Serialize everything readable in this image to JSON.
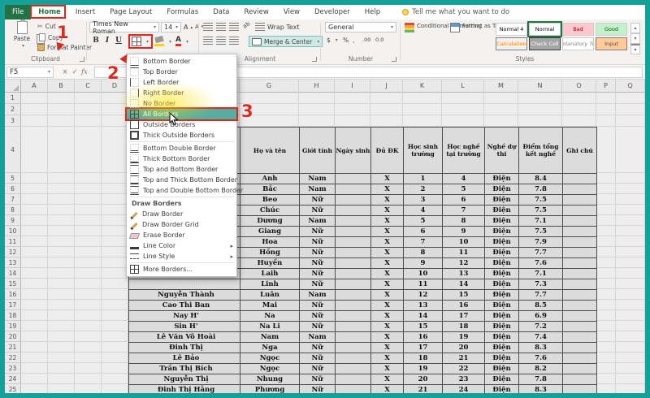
{
  "colors": {
    "frame": "#16a09a",
    "excel_green": "#217346",
    "annotation_red": "#e0251b",
    "highlight_yellow": "#ffe000",
    "menu_hover_teal": "#57aea0",
    "merge_highlight": "#cdeae6"
  },
  "tabs": {
    "items": [
      "File",
      "Home",
      "Insert",
      "Page Layout",
      "Formulas",
      "Data",
      "Review",
      "View",
      "Developer",
      "Help"
    ],
    "active": "Home",
    "tell_me": "Tell me what you want to do"
  },
  "ribbon": {
    "clipboard": {
      "paste": "Paste",
      "cut": "Cut",
      "copy": "Copy",
      "format_painter": "Format Painter",
      "label": "Clipboard"
    },
    "font": {
      "font_name": "Times New Roman",
      "font_size": "14",
      "bold": "B",
      "italic": "I",
      "underline": "U"
    },
    "alignment": {
      "wrap_text": "Wrap Text",
      "merge_center": "Merge & Center",
      "label": "Alignment"
    },
    "number": {
      "format": "General",
      "currency": "$",
      "percent": "%",
      "comma": ",",
      "decimal_increase": ".00",
      "decimal_decrease": "0.0",
      "label": "Number"
    },
    "styles": {
      "conditional": "Conditional Formatting",
      "format_table": "Format as Table",
      "label": "Styles",
      "gallery": [
        {
          "name": "Normal 4",
          "bg": "#ffffff",
          "color": "#000000"
        },
        {
          "name": "Normal",
          "bg": "#ffffff",
          "color": "#000000",
          "selected": true
        },
        {
          "name": "Bad",
          "bg": "#ffc7ce",
          "color": "#9c0006"
        },
        {
          "name": "Good",
          "bg": "#c6efce",
          "color": "#006100"
        },
        {
          "name": "Calculation",
          "bg": "#f2f2f2",
          "color": "#fa7d00",
          "border": "#7f7f7f"
        },
        {
          "name": "Check Cell",
          "bg": "#a5a5a5",
          "color": "#ffffff",
          "border": "#3f3f3f"
        },
        {
          "name": "Explanatory Text",
          "bg": "#ffffff",
          "color": "#7f7f7f",
          "italic": true
        },
        {
          "name": "Input",
          "bg": "#ffcc99",
          "color": "#3f3f76",
          "border": "#7f7f7f"
        }
      ]
    }
  },
  "formula_bar": {
    "name_box": "F5",
    "cancel": "×",
    "enter": "✓",
    "fx": "fx"
  },
  "sheet": {
    "columns": [
      "A",
      "B",
      "C",
      "D",
      "E",
      "F",
      "G",
      "H",
      "I",
      "J",
      "K",
      "L",
      "M",
      "N",
      "O",
      "P",
      "Q"
    ],
    "visible_rows": 25
  },
  "menu": {
    "items": [
      {
        "type": "item",
        "label": "Bottom Border",
        "icon": "bottom"
      },
      {
        "type": "item",
        "label": "Top Border",
        "icon": "top"
      },
      {
        "type": "item",
        "label": "Left Border",
        "icon": "left"
      },
      {
        "type": "item",
        "label": "Right Border",
        "icon": "right"
      },
      {
        "type": "item",
        "label": "No Border",
        "icon": "none"
      },
      {
        "type": "item",
        "label": "All Borders",
        "icon": "all",
        "highlight": true
      },
      {
        "type": "item",
        "label": "Outside Borders",
        "icon": "outside"
      },
      {
        "type": "item",
        "label": "Thick Outside Borders",
        "icon": "thick-outside"
      },
      {
        "type": "sep"
      },
      {
        "type": "item",
        "label": "Bottom Double Border",
        "icon": "bottom-double"
      },
      {
        "type": "item",
        "label": "Thick Bottom Border",
        "icon": "thick-bottom"
      },
      {
        "type": "item",
        "label": "Top and Bottom Border",
        "icon": "top-bottom"
      },
      {
        "type": "item",
        "label": "Top and Thick Bottom Border",
        "icon": "top-thick-bottom"
      },
      {
        "type": "item",
        "label": "Top and Double Bottom Border",
        "icon": "top-double-bottom"
      },
      {
        "type": "sep"
      },
      {
        "type": "header",
        "label": "Draw Borders"
      },
      {
        "type": "item",
        "label": "Draw Border",
        "icon": "draw"
      },
      {
        "type": "item",
        "label": "Draw Border Grid",
        "icon": "draw-grid"
      },
      {
        "type": "item",
        "label": "Erase Border",
        "icon": "erase"
      },
      {
        "type": "item",
        "label": "Line Color",
        "icon": "line-color",
        "submenu": true
      },
      {
        "type": "item",
        "label": "Line Style",
        "icon": "line-style",
        "submenu": true
      },
      {
        "type": "sep"
      },
      {
        "type": "item",
        "label": "More Borders...",
        "icon": "more"
      }
    ]
  },
  "annotations": {
    "step1": "1",
    "step2": "2",
    "step3": "3"
  },
  "table": {
    "headers": [
      "",
      "Họ và tên",
      "Giới tính",
      "Ngày sinh",
      "Đủ ĐK",
      "Học sinh trường",
      "Học nghề tại trường",
      "Nghề dự thi",
      "Điểm tổng kết nghề",
      "Ghi chú"
    ],
    "rows": [
      {
        "family": "",
        "given": "Anh",
        "gender": "Nam",
        "birth": "",
        "qualified": "X",
        "school_no": "1",
        "vocation_no": "4",
        "job": "Điện",
        "score": "8.4",
        "note": ""
      },
      {
        "family": "",
        "given": "Bắc",
        "gender": "Nam",
        "birth": "",
        "qualified": "X",
        "school_no": "2",
        "vocation_no": "5",
        "job": "Điện",
        "score": "7.8",
        "note": ""
      },
      {
        "family": "",
        "given": "Beo",
        "gender": "Nữ",
        "birth": "",
        "qualified": "X",
        "school_no": "3",
        "vocation_no": "6",
        "job": "Điện",
        "score": "7.5",
        "note": ""
      },
      {
        "family": "",
        "given": "Chúc",
        "gender": "Nữ",
        "birth": "",
        "qualified": "X",
        "school_no": "4",
        "vocation_no": "7",
        "job": "Điện",
        "score": "7.5",
        "note": ""
      },
      {
        "family": "",
        "given": "Dương",
        "gender": "Nam",
        "birth": "",
        "qualified": "X",
        "school_no": "5",
        "vocation_no": "8",
        "job": "Điện",
        "score": "7.1",
        "note": ""
      },
      {
        "family": "",
        "given": "Giang",
        "gender": "Nữ",
        "birth": "",
        "qualified": "X",
        "school_no": "6",
        "vocation_no": "9",
        "job": "Điện",
        "score": "7.5",
        "note": ""
      },
      {
        "family": "",
        "given": "Hoa",
        "gender": "Nữ",
        "birth": "",
        "qualified": "X",
        "school_no": "7",
        "vocation_no": "10",
        "job": "Điện",
        "score": "7.9",
        "note": ""
      },
      {
        "family": "",
        "given": "Hồng",
        "gender": "Nữ",
        "birth": "",
        "qualified": "X",
        "school_no": "8",
        "vocation_no": "11",
        "job": "Điện",
        "score": "7.7",
        "note": ""
      },
      {
        "family": "",
        "given": "Huyền",
        "gender": "Nữ",
        "birth": "",
        "qualified": "X",
        "school_no": "9",
        "vocation_no": "12",
        "job": "Điện",
        "score": "7.6",
        "note": ""
      },
      {
        "family": "",
        "given": "Laih",
        "gender": "Nữ",
        "birth": "",
        "qualified": "X",
        "school_no": "10",
        "vocation_no": "13",
        "job": "Điện",
        "score": "7.1",
        "note": ""
      },
      {
        "family": "",
        "given": "Linh",
        "gender": "Nữ",
        "birth": "",
        "qualified": "X",
        "school_no": "11",
        "vocation_no": "14",
        "job": "Điện",
        "score": "7.3",
        "note": ""
      },
      {
        "family": "Nguyễn Thành",
        "given": "Luân",
        "gender": "Nam",
        "birth": "",
        "qualified": "X",
        "school_no": "12",
        "vocation_no": "15",
        "job": "Điện",
        "score": "7.7",
        "note": ""
      },
      {
        "family": "Cao Thi Ban",
        "given": "Mai",
        "gender": "Nữ",
        "birth": "",
        "qualified": "X",
        "school_no": "13",
        "vocation_no": "16",
        "job": "Điện",
        "score": "8.5",
        "note": ""
      },
      {
        "family": "Nay H'",
        "given": "Na",
        "gender": "Nữ",
        "birth": "",
        "qualified": "X",
        "school_no": "14",
        "vocation_no": "17",
        "job": "Điện",
        "score": "6.9",
        "note": ""
      },
      {
        "family": "Sin H'",
        "given": "Na Li",
        "gender": "Nữ",
        "birth": "",
        "qualified": "X",
        "school_no": "15",
        "vocation_no": "18",
        "job": "Điện",
        "score": "7.2",
        "note": ""
      },
      {
        "family": "Lê Văn Võ Hoài",
        "given": "Nam",
        "gender": "Nam",
        "birth": "",
        "qualified": "X",
        "school_no": "16",
        "vocation_no": "19",
        "job": "Điện",
        "score": "7.4",
        "note": ""
      },
      {
        "family": "Đinh Thị",
        "given": "Nga",
        "gender": "Nữ",
        "birth": "",
        "qualified": "X",
        "school_no": "17",
        "vocation_no": "20",
        "job": "Điện",
        "score": "8.3",
        "note": ""
      },
      {
        "family": "Lê Bảo",
        "given": "Ngọc",
        "gender": "Nữ",
        "birth": "",
        "qualified": "X",
        "school_no": "18",
        "vocation_no": "21",
        "job": "Điện",
        "score": "7.6",
        "note": ""
      },
      {
        "family": "Trần Thị Bích",
        "given": "Ngọc",
        "gender": "Nữ",
        "birth": "",
        "qualified": "X",
        "school_no": "19",
        "vocation_no": "22",
        "job": "Điện",
        "score": "8.2",
        "note": ""
      },
      {
        "family": "Nguyễn Thị",
        "given": "Nhung",
        "gender": "Nữ",
        "birth": "",
        "qualified": "X",
        "school_no": "20",
        "vocation_no": "23",
        "job": "Điện",
        "score": "7.8",
        "note": ""
      },
      {
        "family": "Đinh Thị Hằng",
        "given": "Phương",
        "gender": "Nữ",
        "birth": "",
        "qualified": "X",
        "school_no": "21",
        "vocation_no": "24",
        "job": "Điện",
        "score": "8.3",
        "note": ""
      }
    ]
  }
}
